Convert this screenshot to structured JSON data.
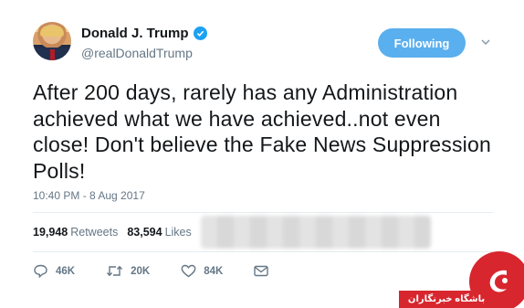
{
  "author": {
    "display_name": "Donald J. Trump",
    "handle": "@realDonaldTrump",
    "verified": true,
    "avatar_icon": "profile-photo"
  },
  "follow_button": {
    "label": "Following",
    "color": "#5aafee"
  },
  "tweet": {
    "text": "After 200 days, rarely has any Administration achieved what we have achieved..not even close! Don't believe the Fake News Suppression Polls!",
    "timestamp": "10:40 PM - 8 Aug 2017"
  },
  "stats": {
    "retweets_count": "19,948",
    "retweets_label": "Retweets",
    "likes_count": "83,594",
    "likes_label": "Likes"
  },
  "actions": {
    "replies": "46K",
    "retweets": "20K",
    "likes": "84K"
  },
  "watermark": {
    "text": "باشگاه خبرنگاران",
    "color": "#d8262e"
  },
  "colors": {
    "accent": "#1da1f2",
    "muted": "#657786",
    "text": "#14171a"
  }
}
